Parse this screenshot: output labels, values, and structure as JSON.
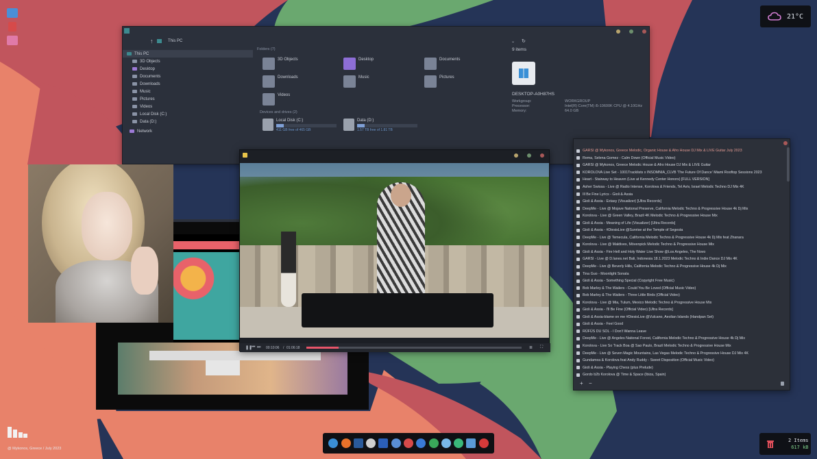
{
  "weather": {
    "temp": "21°C",
    "icon": "cloud-icon"
  },
  "trash_widget": {
    "count": "2 Items",
    "size": "617 kB",
    "icon": "trash-icon"
  },
  "caption": {
    "line1": "@ Mykonos, Greece /  July 2023"
  },
  "explorer": {
    "breadcrumb": "This PC",
    "sidebar": [
      {
        "label": "This PC",
        "sel": true
      },
      {
        "label": "3D Objects"
      },
      {
        "label": "Desktop"
      },
      {
        "label": "Documents"
      },
      {
        "label": "Downloads"
      },
      {
        "label": "Music"
      },
      {
        "label": "Pictures"
      },
      {
        "label": "Videos"
      },
      {
        "label": "Local Disk (C:)"
      },
      {
        "label": "Data (D:)"
      },
      {
        "label": "Network"
      }
    ],
    "folders_header": "Folders (7)",
    "folders": [
      "3D Objects",
      "Desktop",
      "Documents",
      "Downloads",
      "Music",
      "Pictures",
      "Videos"
    ],
    "drives_header": "Devices and drives (2)",
    "drives": [
      {
        "name": "Local Disk (C:)",
        "free": "411 GB free of 465 GB",
        "used_fraction": 0.12
      },
      {
        "name": "Data (D:)",
        "free": "1.57 TB free of 1.81 TB",
        "used_fraction": 0.13
      }
    ],
    "details": {
      "count": "9 items",
      "pc_name": "DESKTOP-A0H87HS",
      "workgroup_label": "Workgroup:",
      "workgroup": "WORKGROUP",
      "processor_label": "Processor:",
      "processor": "Intel(R) Core(TM) i5-10600K CPU @ 4.10GHz",
      "memory_label": "Memory:",
      "memory": "64.0 GB"
    }
  },
  "player": {
    "time_current": "00:10:06",
    "time_sep": "/",
    "time_total": "01:06:18",
    "progress_fraction": 0.15
  },
  "playlist": {
    "items": [
      "GARSI @ Mykonos, Greece   Melodic, Organic House & Afro House DJ Mix & LIVE Guitar  July 2023",
      "Rema, Selena Gomez - Calm Down (Official Music Video)",
      "GARSI @ Mykonos, Greece   Melodic House & Afro House DJ Mix & LIVE Guitar",
      "KOROLOVA Live Set - 1001Tracklists x INSOMNIA_CLVB 'The Future Of Dance' Miami Rooftop Sessions 2023",
      "Heart - Stairway to Heaven (Live at Kennedy Center Honors) [FULL VERSION]",
      "Asher Swissa - Live @ Radio Intense, Korolova & Friends, Tel Aviv, Israel   Melodic Techno DJ Mix 4K",
      "Ill Be Fine Lyrics - Gioli & Assia",
      "Gioli & Assia - Extasy (Visualizer) [Ultra Records]",
      "DeepMe - Live @ Mojave National Preserve, California   Melodic Techno & Progressive House 4k Dj Mix",
      "Korolova - Live @ Green Valley, Brazil   4K Melodic Techno & Progressive House Mix",
      "Gioli & Assia - Meaning of Life (Visualizer) [Ultra Records]",
      "Gioli & Assia - #DiesisLive @Sunrise at the Temple of Segesta",
      "DeepMe - Live @ Temecula, California   Melodic Techno & Progressive House 4k Dj Mix feat Zhanara",
      "Korolova - Live @ Maldives, Mövenpick   Melodic Techno & Progressive House Mix",
      "Gioli & Assia -   Fire Hell and Holy Water  Live Show @Los Angeles, The Novo",
      "GARSI - Live @ D.lanes.net Bali, Indonesia 18.1.2023   Melodic Techno & Indie Dance DJ Mix 4K",
      "DeepMe - Live @ Beverly Hills, California   Melodic Techno & Progressive House 4k Dj Mix",
      "Tina Guo - Moonlight Sonata",
      "Gioli & Assia - Something Special (Copyright Free Music)",
      "Bob Marley & The Wailers - Could You Be Loved (Official Music Video)",
      "Bob Marley & The Wailers - Three Little Birds (Official Video)",
      "Korolova - Live @ Mia, Tulum, Mexico   Melodic Techno & Progressive House Mix",
      "Gioli & Assia - I'll Be Fine (Official Video) [Ultra Records]",
      "Gioli & Assia-blame on me #DiesisLive @Vulcano, Aeolian Islands (Handpan Set)",
      "Gioli & Assia - Feel Good",
      "RÜFÜS DU SOL - I Don't Wanna Leave",
      "DeepMe - Live @ Angeles National Forest, California   Melodic Techno & Progressive House 4k Dj Mix",
      "Korolova - Live So Track Boa @ Sao Paulo, Brazil   Melodic Techno & Progressive House Mix",
      "DeepMe - Live @ Seven Magic Mountains, Las Vegas   Melodic Techno & Progressive House DJ Mix 4K",
      "Gundamea & Korolova feat Andy Ruddy - Sweet Disposition (Official Music Video)",
      "Gioli & Assia - Playing Chess (plus Prelude)",
      "Gordo b2b Korolova @ Time & Space (Ibiza, Spain)"
    ],
    "add_label": "+",
    "remove_label": "−"
  },
  "dock": [
    "finder-icon",
    "firefox-icon",
    "photoshop-icon",
    "sound-icon",
    "word-icon",
    "monitor-icon",
    "music-icon",
    "settings-icon",
    "chat-icon",
    "search-icon",
    "download-icon",
    "trash-icon",
    "power-icon"
  ],
  "colors": {
    "accent": "#e39a92",
    "panel": "#2b303b",
    "wall_red": "#c1555d",
    "wall_orange": "#e8826a",
    "wall_green": "#6aa86f",
    "wall_navy": "#253457"
  }
}
